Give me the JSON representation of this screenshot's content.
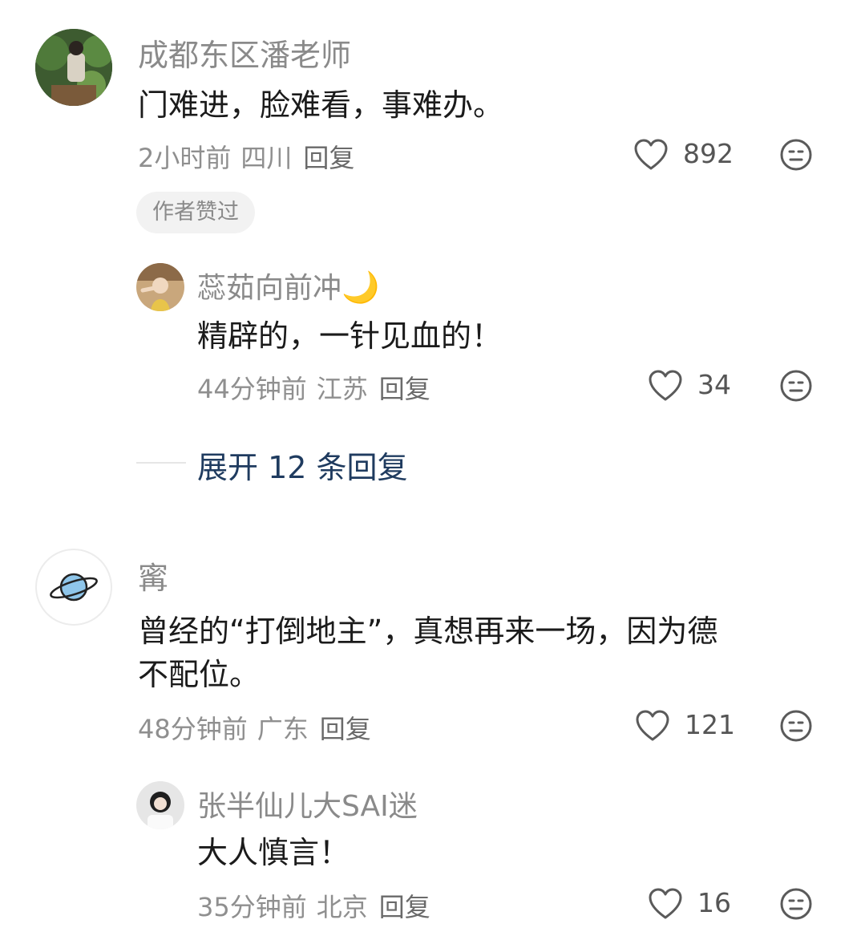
{
  "comments": [
    {
      "author": "成都东区潘老师",
      "text": "门难进，脸难看，事难办。",
      "time": "2小时前",
      "location": "四川",
      "reply_label": "回复",
      "likes": "892",
      "badge": "作者赞过",
      "replies": [
        {
          "author": "蕊茹向前冲",
          "author_emoji": "🌙",
          "text": "精辟的，一针见血的！",
          "time": "44分钟前",
          "location": "江苏",
          "reply_label": "回复",
          "likes": "34"
        }
      ],
      "expand_label": "展开 12 条回复"
    },
    {
      "author": "寗",
      "text_line1": "曾经的“打倒地主”，真想再来一场，因为德",
      "text_line2": "不配位。",
      "time": "48分钟前",
      "location": "广东",
      "reply_label": "回复",
      "likes": "121",
      "replies": [
        {
          "author": "张半仙儿大SAI迷",
          "text": "大人慎言！",
          "time": "35分钟前",
          "location": "北京",
          "reply_label": "回复",
          "likes": "16"
        }
      ]
    }
  ],
  "icons": {
    "like": "heart-outline-icon",
    "dislike": "neutral-face-icon"
  },
  "colors": {
    "expand_link": "#1f3b5f",
    "meta_gray": "#8f8f8f",
    "badge_bg": "#f2f2f2"
  }
}
